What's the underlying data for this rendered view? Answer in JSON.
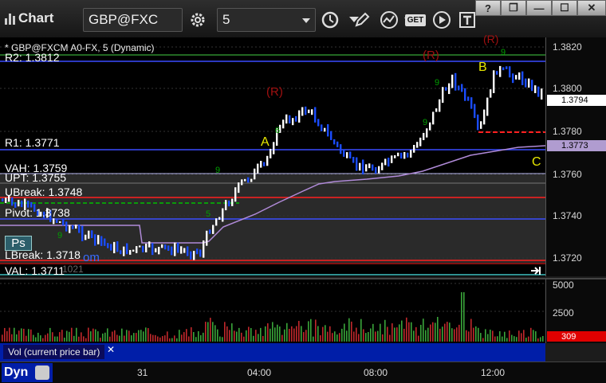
{
  "app": {
    "title": "Chart"
  },
  "toolbar": {
    "symbol": "GBP@FXC",
    "interval": "5",
    "get_label": "GET"
  },
  "window_controls": [
    "?",
    "❐",
    "—",
    "☐",
    "✕"
  ],
  "chart": {
    "header": "* GBP@FXCM A0-FX, 5 (Dynamic)",
    "lines": {
      "r2": "R2: 1.3812",
      "r1": "R1: 1.3771",
      "vah": "VAH: 1.3759",
      "upt": "UPT: 1.3755",
      "ubreak": "UBreak: 1.3748",
      "pivot": "Pivot: 1.3738",
      "lbreak": "LBreak: 1.3718",
      "val": "VAL: 1.3711"
    },
    "partial_texts": {
      "ps": "Ps",
      "om": "om",
      "date_frag": "1021",
      "r_top": "(R)"
    },
    "letters": {
      "a": "A",
      "b": "B",
      "c": "C",
      "r_mid": "(R)",
      "r_up": "(R)"
    },
    "price_ticks": [
      "1.3820",
      "1.3800",
      "1.3780",
      "1.3760",
      "1.3740",
      "1.3720"
    ],
    "last_price_tag": "1.3794",
    "vwap_tag": "1.3773",
    "colors": {
      "background": "#000000",
      "up_bar": "#ffffff",
      "down_bar": "#1a4cff",
      "vwap": "#b08ad8",
      "r2": "#3a4cff",
      "pivot_level": "#ff2020"
    }
  },
  "volume": {
    "ticks": [
      "5000",
      "2500",
      "0"
    ],
    "label": "Vol (current price bar)",
    "current_tag": "309"
  },
  "time_axis": {
    "labels": [
      "31",
      "04:00",
      "08:00",
      "12:00"
    ]
  },
  "status": {
    "dyn": "Dyn"
  }
}
